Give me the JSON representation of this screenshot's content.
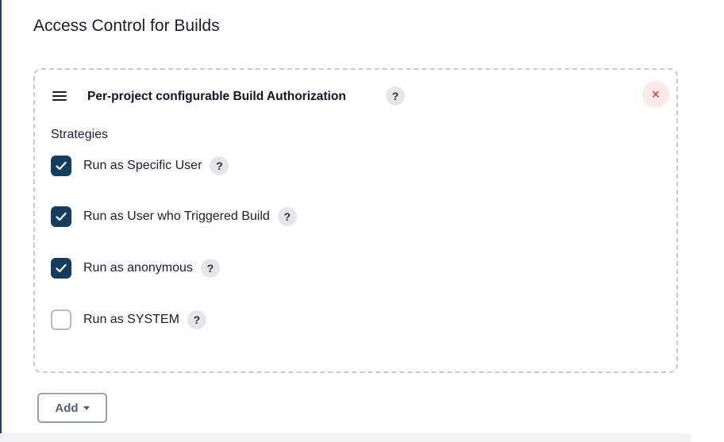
{
  "section": {
    "title": "Access Control for Builds"
  },
  "card": {
    "title": "Per-project configurable Build Authorization",
    "help_icon": "?",
    "close_icon": "×",
    "strategies_label": "Strategies",
    "options": [
      {
        "label": "Run as Specific User",
        "checked": true,
        "help": "?"
      },
      {
        "label": "Run as User who Triggered Build",
        "checked": true,
        "help": "?"
      },
      {
        "label": "Run as anonymous",
        "checked": true,
        "help": "?"
      },
      {
        "label": "Run as SYSTEM",
        "checked": false,
        "help": "?"
      }
    ]
  },
  "add_button": {
    "label": "Add"
  },
  "colors": {
    "checkbox_checked": "#143d5e",
    "close_button_bg": "#fde8ea",
    "close_icon": "#e0203a",
    "card_border": "#c9c9d1"
  }
}
